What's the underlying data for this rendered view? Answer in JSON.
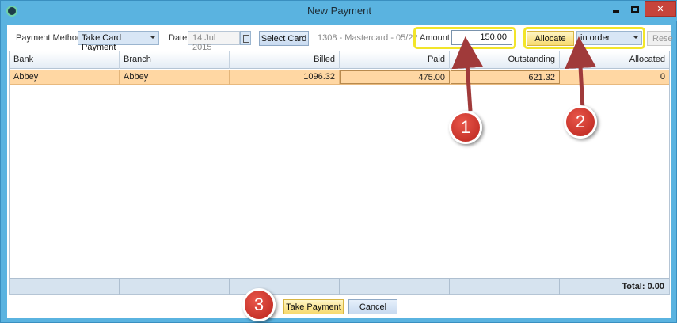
{
  "window": {
    "title": "New Payment"
  },
  "toolbar": {
    "payment_method_label": "Payment Method",
    "payment_method_value": "Take Card Payment",
    "date_label": "Date",
    "date_value": "14 Jul 2015",
    "select_card_label": "Select Card",
    "card_info": "1308 - Mastercard - 05/22",
    "amount_label": "Amount",
    "amount_value": "150.00",
    "allocate_label": "Allocate",
    "allocate_mode": "in order",
    "reset_label": "Rese"
  },
  "grid": {
    "columns": [
      "Bank",
      "Branch",
      "Billed",
      "Paid",
      "Outstanding",
      "Allocated"
    ],
    "rows": [
      {
        "bank": "Abbey",
        "branch": "Abbey",
        "billed": "1096.32",
        "paid": "475.00",
        "outstanding": "621.32",
        "allocated": "0"
      }
    ],
    "total_label": "Total: 0.00"
  },
  "footer": {
    "take_payment_label": "Take Payment",
    "cancel_label": "Cancel"
  },
  "callouts": [
    "1",
    "2",
    "3"
  ],
  "colors": {
    "title_bar": "#5ab3e0",
    "close_button": "#c7443b",
    "highlight": "#f2e52a",
    "selected_row": "#ffd7a3",
    "callout": "#c9322a",
    "arrow": "#a03a3a"
  }
}
